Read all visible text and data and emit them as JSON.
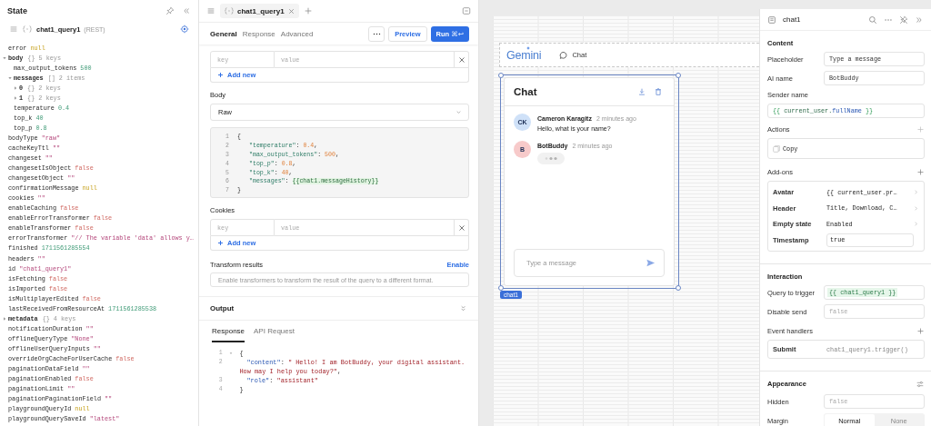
{
  "state_panel": {
    "title": "State",
    "query": {
      "name": "chat1_query1",
      "type": "(REST)"
    },
    "tree": [
      {
        "key": "error",
        "kind": "null",
        "value": "null"
      },
      {
        "key": "body",
        "kind": "object",
        "brackets": "{}",
        "meta": "5 keys",
        "expanded": true,
        "children": [
          {
            "key": "max_output_tokens",
            "kind": "number",
            "value": "500"
          },
          {
            "key": "messages",
            "kind": "array",
            "brackets": "[]",
            "meta": "2 items",
            "expanded": true,
            "children": [
              {
                "key": "0",
                "kind": "object",
                "brackets": "{}",
                "meta": "2 keys",
                "expanded": false
              },
              {
                "key": "1",
                "kind": "object",
                "brackets": "{}",
                "meta": "2 keys",
                "expanded": false
              }
            ]
          },
          {
            "key": "temperature",
            "kind": "number",
            "value": "0.4"
          },
          {
            "key": "top_k",
            "kind": "number",
            "value": "40"
          },
          {
            "key": "top_p",
            "kind": "number",
            "value": "0.8"
          }
        ]
      },
      {
        "key": "bodyType",
        "kind": "string",
        "value": "\"raw\""
      },
      {
        "key": "cacheKeyTtl",
        "kind": "string",
        "value": "\"\""
      },
      {
        "key": "changeset",
        "kind": "string",
        "value": "\"\""
      },
      {
        "key": "changesetIsObject",
        "kind": "boolean",
        "value": "false"
      },
      {
        "key": "changesetObject",
        "kind": "string",
        "value": "\"\""
      },
      {
        "key": "confirmationMessage",
        "kind": "null",
        "value": "null"
      },
      {
        "key": "cookies",
        "kind": "string",
        "value": "\"\""
      },
      {
        "key": "enableCaching",
        "kind": "boolean",
        "value": "false"
      },
      {
        "key": "enableErrorTransformer",
        "kind": "boolean",
        "value": "false"
      },
      {
        "key": "enableTransformer",
        "kind": "boolean",
        "value": "false"
      },
      {
        "key": "errorTransformer",
        "kind": "string",
        "value": "\"// The variable 'data' allows y…"
      },
      {
        "key": "finished",
        "kind": "number",
        "value": "1711561285554"
      },
      {
        "key": "headers",
        "kind": "string",
        "value": "\"\""
      },
      {
        "key": "id",
        "kind": "string",
        "value": "\"chat1_query1\""
      },
      {
        "key": "isFetching",
        "kind": "boolean",
        "value": "false"
      },
      {
        "key": "isImported",
        "kind": "boolean",
        "value": "false"
      },
      {
        "key": "isMultiplayerEdited",
        "kind": "boolean",
        "value": "false"
      },
      {
        "key": "lastReceivedFromResourceAt",
        "kind": "number",
        "value": "1711561285538"
      },
      {
        "key": "metadata",
        "kind": "object",
        "brackets": "{}",
        "meta": "4 keys",
        "expanded": false
      },
      {
        "key": "notificationDuration",
        "kind": "string",
        "value": "\"\""
      },
      {
        "key": "offlineQueryType",
        "kind": "string",
        "value": "\"None\""
      },
      {
        "key": "offlineUserQueryInputs",
        "kind": "string",
        "value": "\"\""
      },
      {
        "key": "overrideOrgCacheForUserCache",
        "kind": "boolean",
        "value": "false"
      },
      {
        "key": "paginationDataField",
        "kind": "string",
        "value": "\"\""
      },
      {
        "key": "paginationEnabled",
        "kind": "boolean",
        "value": "false"
      },
      {
        "key": "paginationLimit",
        "kind": "string",
        "value": "\"\""
      },
      {
        "key": "paginationPaginationField",
        "kind": "string",
        "value": "\"\""
      },
      {
        "key": "playgroundQueryId",
        "kind": "null",
        "value": "null"
      },
      {
        "key": "playgroundQuerySaveId",
        "kind": "string",
        "value": "\"latest\""
      }
    ]
  },
  "query_editor": {
    "tab_name": "chat1_query1",
    "tabs": [
      {
        "label": "General",
        "selected": true
      },
      {
        "label": "Response",
        "selected": false
      },
      {
        "label": "Advanced",
        "selected": false
      }
    ],
    "preview": "Preview",
    "run": "Run",
    "run_shortcut": "⌘↩",
    "headers_table": {
      "key_placeholder": "key",
      "value_placeholder": "value",
      "add": "Add new"
    },
    "body": {
      "label": "Body",
      "select": "Raw",
      "code": [
        {
          "number": "1",
          "indent": false,
          "tokens": [
            {
              "kind": "punct",
              "text": "{"
            }
          ]
        },
        {
          "number": "2",
          "indent": true,
          "tokens": [
            {
              "kind": "key",
              "text": "\"temperature\""
            },
            {
              "kind": "punct",
              "text": ": "
            },
            {
              "kind": "number",
              "text": "0.4"
            },
            {
              "kind": "punct",
              "text": ","
            }
          ]
        },
        {
          "number": "3",
          "indent": true,
          "tokens": [
            {
              "kind": "key",
              "text": "\"max_output_tokens\""
            },
            {
              "kind": "punct",
              "text": ": "
            },
            {
              "kind": "number",
              "text": "500"
            },
            {
              "kind": "punct",
              "text": ","
            }
          ]
        },
        {
          "number": "4",
          "indent": true,
          "tokens": [
            {
              "kind": "key",
              "text": "\"top_p\""
            },
            {
              "kind": "punct",
              "text": ": "
            },
            {
              "kind": "number",
              "text": "0.8"
            },
            {
              "kind": "punct",
              "text": ","
            }
          ]
        },
        {
          "number": "5",
          "indent": true,
          "tokens": [
            {
              "kind": "key",
              "text": "\"top_k\""
            },
            {
              "kind": "punct",
              "text": ": "
            },
            {
              "kind": "number",
              "text": "40"
            },
            {
              "kind": "punct",
              "text": ","
            }
          ]
        },
        {
          "number": "6",
          "indent": true,
          "tokens": [
            {
              "kind": "key",
              "text": "\"messages\""
            },
            {
              "kind": "punct",
              "text": ": "
            },
            {
              "kind": "template",
              "text": "{{chat1.messageHistory}}"
            }
          ]
        },
        {
          "number": "7",
          "indent": false,
          "tokens": [
            {
              "kind": "punct",
              "text": "}"
            }
          ]
        }
      ]
    },
    "cookies": {
      "label": "Cookies",
      "key_placeholder": "key",
      "value_placeholder": "value",
      "add": "Add new"
    },
    "transform": {
      "label": "Transform results",
      "link": "Enable",
      "placeholder": "Enable transformers to transform the result of the query to a different format."
    },
    "output": {
      "label": "Output",
      "tabs": [
        {
          "label": "Response",
          "selected": true
        },
        {
          "label": "API Request",
          "selected": false
        }
      ],
      "code": [
        {
          "number": "1",
          "fold": true,
          "indent": false,
          "tokens": [
            {
              "kind": "punct",
              "text": "{"
            }
          ]
        },
        {
          "number": "2",
          "fold": false,
          "indent": true,
          "tokens": [
            {
              "kind": "key",
              "text": "\"content\""
            },
            {
              "kind": "punct",
              "text": ": "
            },
            {
              "kind": "string",
              "text": "\" Hello! I am BotBuddy, your digital assistant. How may I help you today?\""
            },
            {
              "kind": "punct",
              "text": ","
            }
          ]
        },
        {
          "number": "3",
          "fold": false,
          "indent": true,
          "tokens": [
            {
              "kind": "key",
              "text": "\"role\""
            },
            {
              "kind": "punct",
              "text": ": "
            },
            {
              "kind": "string",
              "text": "\"assistant\""
            }
          ]
        },
        {
          "number": "4",
          "fold": false,
          "indent": false,
          "tokens": [
            {
              "kind": "punct",
              "text": "}"
            }
          ]
        }
      ]
    }
  },
  "canvas": {
    "header": {
      "logo": "Gemini",
      "nav": "Chat"
    },
    "chat": {
      "component_name": "chat1",
      "title": "Chat",
      "input_placeholder": "Type a message",
      "messages": [
        {
          "kind": "text",
          "initials": "CK",
          "sender": "Cameron Karagitz",
          "time": "2 minutes ago",
          "text": "Hello, what is your name?",
          "color": "#cfe1f8"
        },
        {
          "kind": "typing",
          "initials": "B",
          "sender": "BotBuddy",
          "time": "2 minutes ago",
          "color": "#f7caca"
        }
      ]
    }
  },
  "inspector": {
    "title": "chat1",
    "content": {
      "heading": "Content",
      "placeholder": {
        "label": "Placeholder",
        "value": "Type a message"
      },
      "ai_name": {
        "label": "AI name",
        "value": "BotBuddy"
      },
      "sender_name": {
        "label": "Sender name",
        "tokens": [
          {
            "kind": "brace",
            "text": "{{ "
          },
          {
            "kind": "ident",
            "text": "current_user."
          },
          {
            "kind": "prop",
            "text": "fullName"
          },
          {
            "kind": "brace",
            "text": " }}"
          }
        ]
      },
      "actions": {
        "label": "Actions",
        "items": [
          "Copy"
        ]
      },
      "addons": {
        "label": "Add-ons",
        "rows": [
          {
            "kind": "link",
            "label": "Avatar",
            "value": "{{ current_user.pr…"
          },
          {
            "kind": "link",
            "label": "Header",
            "value": "Title, Download, C…"
          },
          {
            "kind": "link",
            "label": "Empty state",
            "value": "Enabled"
          },
          {
            "kind": "field",
            "label": "Timestamp",
            "value": "true"
          }
        ]
      }
    },
    "interaction": {
      "heading": "Interaction",
      "query": {
        "label": "Query to trigger",
        "value": "{{ chat1_query1 }}"
      },
      "disable_send": {
        "label": "Disable send",
        "placeholder": "false"
      },
      "event_handlers": {
        "label": "Event handlers",
        "items": [
          {
            "event": "Submit",
            "action": "chat1_query1.trigger()"
          }
        ]
      }
    },
    "appearance": {
      "heading": "Appearance",
      "hidden": {
        "label": "Hidden",
        "placeholder": "false"
      },
      "margin": {
        "label": "Margin",
        "options": [
          {
            "label": "Normal",
            "selected": true
          },
          {
            "label": "None",
            "selected": false
          }
        ]
      }
    }
  }
}
